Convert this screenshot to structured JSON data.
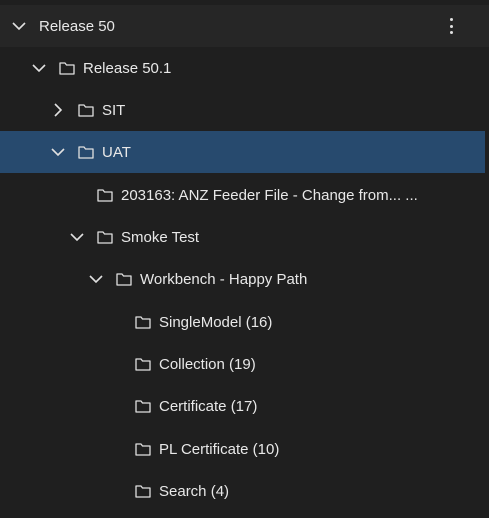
{
  "tree": {
    "root": {
      "label": "Release 50",
      "expanded": true,
      "icon": "chevron-down-icon",
      "menu_icon": "more-vertical-icon"
    },
    "items": [
      {
        "label": "Release 50.1",
        "expanded": true,
        "icon": "folder-icon"
      },
      {
        "label": "SIT",
        "expanded": false,
        "icon": "folder-icon"
      },
      {
        "label": "UAT",
        "expanded": true,
        "selected": true,
        "icon": "folder-icon"
      },
      {
        "label": "203163: ANZ Feeder File - Change from... ...",
        "icon": "folder-icon"
      },
      {
        "label": "Smoke Test",
        "expanded": true,
        "icon": "folder-icon"
      },
      {
        "label": "Workbench - Happy Path",
        "expanded": true,
        "icon": "folder-icon"
      },
      {
        "label": "SingleModel (16)",
        "icon": "folder-icon"
      },
      {
        "label": "Collection (19)",
        "icon": "folder-icon"
      },
      {
        "label": "Certificate (17)",
        "icon": "folder-icon"
      },
      {
        "label": "PL Certificate (10)",
        "icon": "folder-icon"
      },
      {
        "label": "Search (4)",
        "icon": "folder-icon"
      }
    ]
  },
  "colors": {
    "background": "#1f1f1f",
    "header": "#262626",
    "selected": "#274a6e",
    "text": "#e8e8e8"
  }
}
